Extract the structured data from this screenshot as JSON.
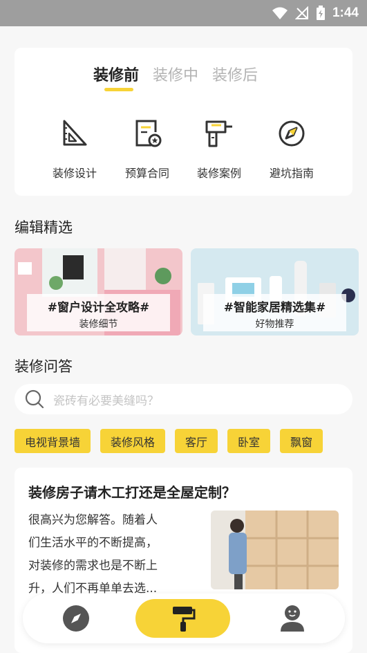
{
  "status_bar": {
    "time": "1:44"
  },
  "tabs": [
    "装修前",
    "装修中",
    "装修后"
  ],
  "features": [
    {
      "label": "装修设计",
      "icon": "set-square-icon"
    },
    {
      "label": "预算合同",
      "icon": "contract-icon"
    },
    {
      "label": "装修案例",
      "icon": "drill-icon"
    },
    {
      "label": "避坑指南",
      "icon": "compass-icon"
    }
  ],
  "editor_picks": {
    "title": "编辑精选",
    "items": [
      {
        "title": "#窗户设计全攻略#",
        "subtitle": "装修细节"
      },
      {
        "title": "#智能家居精选集#",
        "subtitle": "好物推荐"
      }
    ]
  },
  "qa": {
    "title": "装修问答",
    "search_placeholder": "瓷砖有必要美缝吗？",
    "tags": [
      "电视背景墙",
      "装修风格",
      "客厅",
      "卧室",
      "飘窗"
    ],
    "card": {
      "question": "装修房子请木工打还是全屋定制？",
      "answer_lines": [
        "很高兴为您解答。随着人",
        "们生活水平的不断提高，",
        "对装修的需求也是不断上",
        "升，人们不再单单去选..."
      ]
    }
  },
  "colors": {
    "accent": "#f7d337",
    "status_bar": "#9e9e9e"
  }
}
